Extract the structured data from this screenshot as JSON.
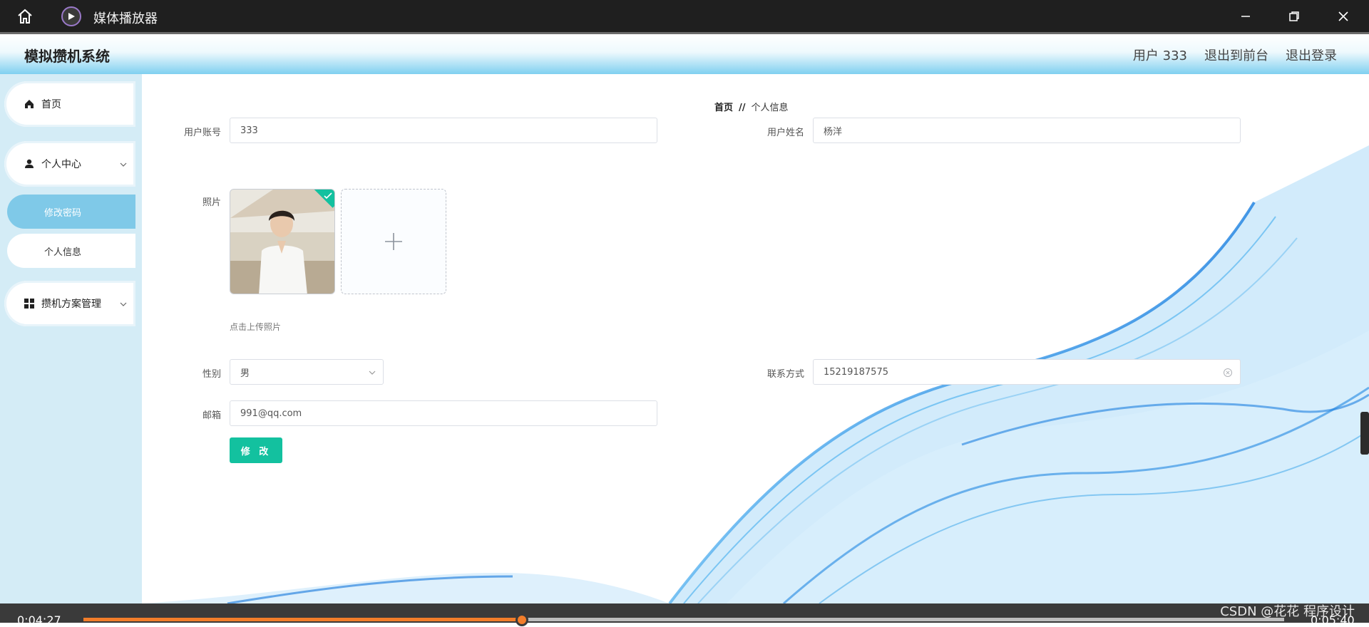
{
  "player": {
    "title": "媒体播放器",
    "current_time": "0:04:27",
    "total_time": "0:05:40",
    "progress": 0.365,
    "watermark": "CSDN @花花 程序设计"
  },
  "header": {
    "brand": "模拟攒机系统",
    "user": "用户 333",
    "to_front": "退出到前台",
    "logout": "退出登录"
  },
  "sidebar": {
    "home": "首页",
    "personal_center": "个人中心",
    "change_password": "修改密码",
    "personal_info": "个人信息",
    "plan_management": "攒机方案管理"
  },
  "breadcrumb": {
    "home": "首页",
    "separator": "//",
    "current": "个人信息"
  },
  "form": {
    "account_label": "用户账号",
    "account_value": "333",
    "name_label": "用户姓名",
    "name_value": "杨洋",
    "photo_label": "照片",
    "upload_hint": "点击上传照片",
    "gender_label": "性别",
    "gender_value": "男",
    "contact_label": "联系方式",
    "contact_value": "15219187575",
    "email_label": "邮箱",
    "email_value": "991@qq.com",
    "submit_label": "修 改"
  },
  "colors": {
    "accent": "#13c19f",
    "sidebar_bg": "#d4ecf6",
    "active_menu": "#7fc9e8",
    "progress": "#f27d2a"
  }
}
